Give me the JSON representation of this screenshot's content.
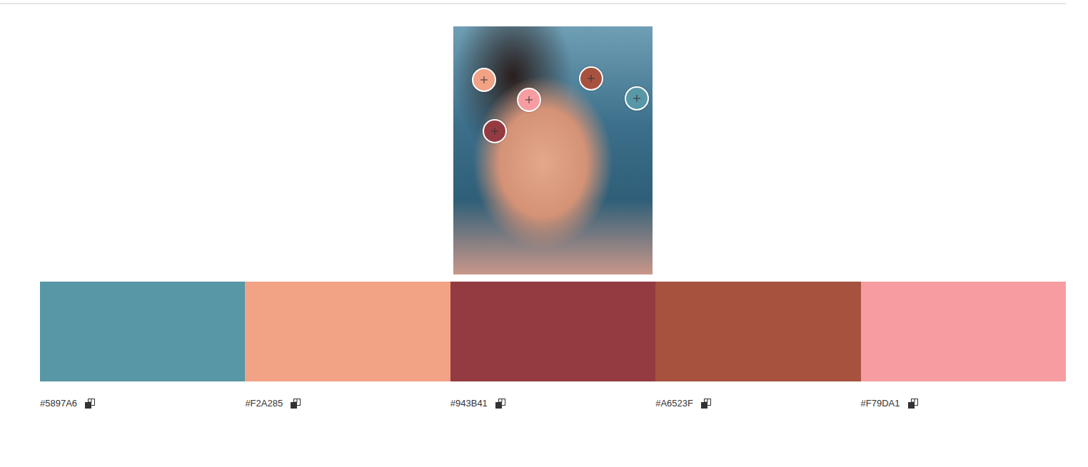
{
  "photo": {
    "label": "photo"
  },
  "swatches": [
    {
      "hex": "#5897A6",
      "color": "#5897A6"
    },
    {
      "hex": "#F2A285",
      "color": "#F2A285"
    },
    {
      "hex": "#943B41",
      "color": "#943B41"
    },
    {
      "hex": "#A6523F",
      "color": "#A6523F"
    },
    {
      "hex": "#F79DA1",
      "color": "#F79DA1"
    }
  ]
}
